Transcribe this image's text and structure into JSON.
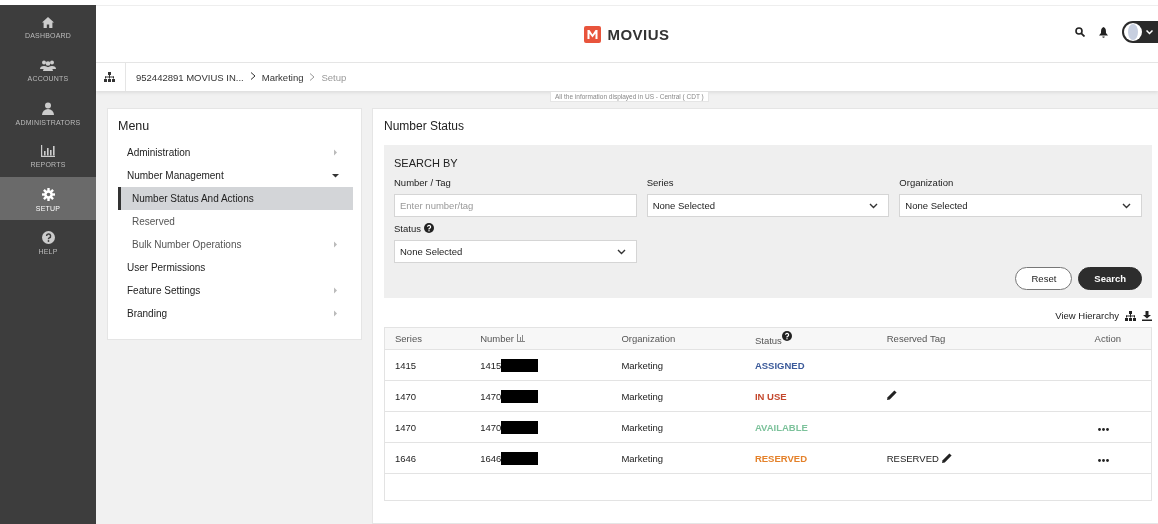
{
  "nav": [
    {
      "label": "DASHBOARD",
      "selected": false
    },
    {
      "label": "ACCOUNTS",
      "selected": false
    },
    {
      "label": "ADMINISTRATORS",
      "selected": false
    },
    {
      "label": "REPORTS",
      "selected": false
    },
    {
      "label": "SETUP",
      "selected": true
    },
    {
      "label": "HELP",
      "selected": false
    }
  ],
  "header": {
    "brand": "MOVIUS"
  },
  "breadcrumb": [
    "952442891 MOVIUS IN...",
    "Marketing",
    "Setup"
  ],
  "timezone_note": "All the information displayed in US - Central ( CDT )",
  "menu": {
    "title": "Menu",
    "items": [
      {
        "label": "Administration",
        "expanded": false,
        "selected": false
      },
      {
        "label": "Number Management",
        "expanded": true,
        "selected": false,
        "children": [
          {
            "label": "Number Status And Actions",
            "selected": true
          },
          {
            "label": "Reserved",
            "selected": false
          },
          {
            "label": "Bulk Number Operations",
            "expanded": false,
            "selected": false
          }
        ]
      },
      {
        "label": "User Permissions",
        "selected": false
      },
      {
        "label": "Feature Settings",
        "expanded": false,
        "selected": false
      },
      {
        "label": "Branding",
        "expanded": false,
        "selected": false
      }
    ]
  },
  "panel": {
    "title": "Number Status",
    "search": {
      "title": "SEARCH BY",
      "fields": [
        {
          "kind": "text",
          "label": "Number / Tag",
          "placeholder": "Enter number/tag"
        },
        {
          "kind": "select",
          "label": "Series",
          "value": "None Selected"
        },
        {
          "kind": "select",
          "label": "Organization",
          "value": "None Selected"
        },
        {
          "kind": "select",
          "label": "Status",
          "value": "None Selected",
          "help": true
        }
      ],
      "buttons": [
        {
          "label": "Reset",
          "kind": "outline"
        },
        {
          "label": "Search",
          "kind": "primary"
        }
      ]
    },
    "view_hierarchy": "View Hierarchy",
    "table": {
      "columns": [
        {
          "label": "Series"
        },
        {
          "label": "Number",
          "sortable": true
        },
        {
          "label": "Organization"
        },
        {
          "label": "Status",
          "help": true
        },
        {
          "label": "Reserved Tag"
        },
        {
          "label": "Action"
        }
      ],
      "rows": [
        {
          "series": "1415",
          "number": "1415",
          "redacted": true,
          "organization": "Marketing",
          "status": "ASSIGNED",
          "color": "#3b5a9a",
          "editable": false,
          "actions": false
        },
        {
          "series": "1470",
          "number": "1470",
          "redacted": true,
          "organization": "Marketing",
          "status": "IN USE",
          "color": "#c4472c",
          "editable": true,
          "actions": false
        },
        {
          "series": "1470",
          "number": "1470",
          "redacted": true,
          "organization": "Marketing",
          "status": "AVAILABLE",
          "color": "#7cc29b",
          "editable": false,
          "actions": true
        },
        {
          "series": "1646",
          "number": "1646",
          "redacted": true,
          "organization": "Marketing",
          "status": "RESERVED",
          "color": "#e4812a",
          "reserved_tag": "RESERVED",
          "editable": true,
          "actions": true
        }
      ]
    }
  }
}
